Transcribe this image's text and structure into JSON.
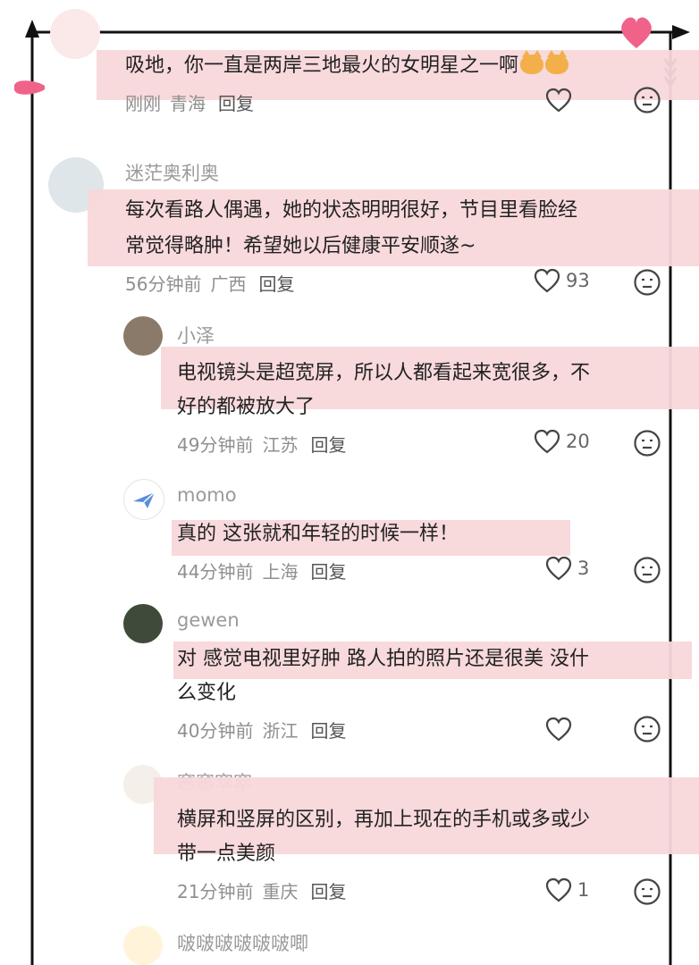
{
  "comments": [
    {
      "text_lines": [
        "吸地，你一直是两岸三地最火的女明星之一啊"
      ],
      "time": "刚刚",
      "location": "青海",
      "reply": "回复",
      "likes": ""
    },
    {
      "username": "迷茫奥利奥",
      "text_lines": [
        "每次看路人偶遇，她的状态明明很好，节目里看脸经",
        "常觉得略肿！希望她以后健康平安顺遂~"
      ],
      "time": "56分钟前",
      "location": "广西",
      "reply": "回复",
      "likes": "93"
    },
    {
      "username": "小泽",
      "text_lines": [
        "电视镜头是超宽屏，所以人都看起来宽很多，不",
        "好的都被放大了"
      ],
      "time": "49分钟前",
      "location": "江苏",
      "reply": "回复",
      "likes": "20"
    },
    {
      "username": "momo",
      "text_lines": [
        "真的 这张就和年轻的时候一样！"
      ],
      "time": "44分钟前",
      "location": "上海",
      "reply": "回复",
      "likes": "3"
    },
    {
      "username": "gewen",
      "text_lines": [
        "对 感觉电视里好肿 路人拍的照片还是很美 没什",
        "么变化"
      ],
      "time": "40分钟前",
      "location": "浙江",
      "reply": "回复",
      "likes": ""
    },
    {
      "username": "窸窸窣窣",
      "text_lines": [
        "横屏和竖屏的区别，再加上现在的手机或多或少",
        "带一点美颜"
      ],
      "time": "21分钟前",
      "location": "重庆",
      "reply": "回复",
      "likes": "1"
    },
    {
      "username": "啵啵啵啵啵啵唧"
    }
  ],
  "colors": {
    "highlight": "#f8d7da",
    "heart": "#f0628a",
    "frame": "#111111"
  },
  "icons": [
    "heart-outline-icon",
    "meh-face-icon",
    "arrow-icon",
    "pink-heart-icon"
  ]
}
